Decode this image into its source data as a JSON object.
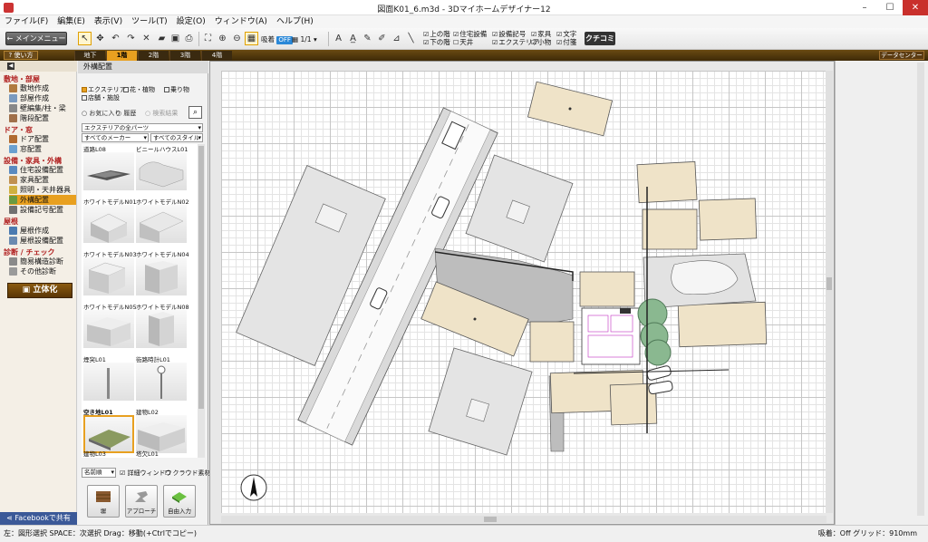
{
  "window": {
    "title": "図面K01_6.m3d - 3Dマイホームデザイナー12",
    "minimize": "–",
    "maximize": "☐",
    "close": "✕"
  },
  "menu": [
    "ファイル(F)",
    "編集(E)",
    "表示(V)",
    "ツール(T)",
    "設定(O)",
    "ウィンドウ(A)",
    "ヘルプ(H)"
  ],
  "toolbar": {
    "back_label": "← メインメニュー",
    "magnet_label": "吸着",
    "magnet_state": "OFF",
    "scale": "1/1",
    "checks": [
      "上の階",
      "下の階",
      "住宅設備",
      "天井",
      "設備記号",
      "エクステリア",
      "家具",
      "小物",
      "文字",
      "付箋"
    ],
    "kuchikomi": "クチコミ"
  },
  "floorbar": {
    "howto": "? 使い方",
    "tabs": [
      "地下",
      "1階",
      "2階",
      "3階",
      "4階"
    ],
    "active": "1階",
    "datacenter": "データセンター"
  },
  "leftnav": {
    "sections": [
      {
        "title": "敷地・部屋",
        "items": [
          "敷地作成",
          "部屋作成",
          "壁編集/柱・梁",
          "階段配置"
        ]
      },
      {
        "title": "ドア・窓",
        "items": [
          "ドア配置",
          "窓配置"
        ]
      },
      {
        "title": "設備・家具・外構",
        "items": [
          "住宅設備配置",
          "家具配置",
          "照明・天井器具",
          "外構配置",
          "設備記号配置"
        ]
      },
      {
        "title": "屋根",
        "items": [
          "屋根作成",
          "屋根設備配置"
        ]
      },
      {
        "title": "診断 / チェック",
        "items": [
          "簡易構造診断",
          "その他診断"
        ]
      }
    ],
    "active_item": "外構配置",
    "rittai_label": "立体化",
    "facebook_label": "Facebookで共有"
  },
  "palette": {
    "title": "外構配置",
    "categories": [
      "エクステリア",
      "花・植物",
      "乗り物",
      "店舗・施設"
    ],
    "active_category": "エクステリア",
    "filters": [
      "お気に入り",
      "履歴",
      "検索結果"
    ],
    "filter1": "エクステリアの全パーツ",
    "maker": "すべてのメーカー",
    "style": "すべてのスタイル",
    "items": [
      "道路L08",
      "ビニールハウスL01",
      "ホワイトモデルN01",
      "ホワイトモデルN02",
      "ホワイトモデルN03",
      "ホワイトモデルN04",
      "ホワイトモデルN05",
      "ホワイトモデルN08",
      "煙突L01",
      "街路時計L01",
      "空き地L01",
      "建物L02",
      "建物L03",
      "塔欠L01"
    ],
    "selected_item": "空き地L01",
    "sort": "名前順",
    "detail_window": "詳細ウィンドウ",
    "cloud": "クラウド素材",
    "buttons": [
      "塀",
      "アプローチ",
      "自由入力"
    ]
  },
  "statusbar": {
    "hint": "左：図形選択 SPACE：次選択 Drag：移動(+Ctrlでコピー)",
    "snap": "吸着：Off グリッド：910mm"
  }
}
